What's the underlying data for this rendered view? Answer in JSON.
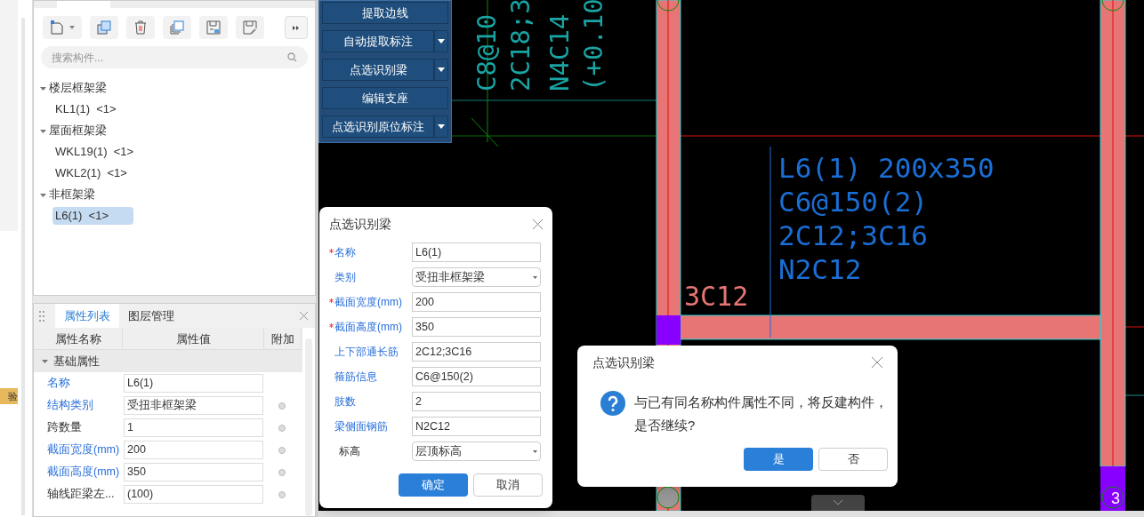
{
  "sidebar_tag": {
    "label": "验"
  },
  "component_panel": {
    "search": {
      "placeholder": "搜索构件..."
    },
    "tree": [
      {
        "label": "楼层框架梁",
        "expanded": true,
        "children": [
          {
            "label": "KL1(1)  <1>",
            "selected": false
          }
        ]
      },
      {
        "label": "屋面框架梁",
        "expanded": true,
        "children": [
          {
            "label": "WKL19(1)  <1>",
            "selected": false
          },
          {
            "label": "WKL2(1)  <1>",
            "selected": false
          }
        ]
      },
      {
        "label": "非框架梁",
        "expanded": true,
        "children": [
          {
            "label": "L6(1)  <1>",
            "selected": true
          }
        ]
      }
    ]
  },
  "property_panel": {
    "tabs": [
      {
        "label": "属性列表",
        "selected": true
      },
      {
        "label": "图层管理",
        "selected": false
      }
    ],
    "columns": [
      "属性名称",
      "属性值",
      "附加"
    ],
    "group": {
      "label": "基础属性",
      "expanded": true
    },
    "rows": [
      {
        "name": "名称",
        "value": "L6(1)",
        "emphasis": true,
        "extra": false
      },
      {
        "name": "结构类别",
        "value": "受扭非框架梁",
        "emphasis": true,
        "extra": true
      },
      {
        "name": "跨数量",
        "value": "1",
        "emphasis": false,
        "extra": true
      },
      {
        "name": "截面宽度(mm)",
        "value": "200",
        "emphasis": true,
        "extra": true
      },
      {
        "name": "截面高度(mm)",
        "value": "350",
        "emphasis": true,
        "extra": true
      },
      {
        "name": "轴线距梁左...",
        "value": "(100)",
        "emphasis": false,
        "extra": true
      }
    ]
  },
  "cad_toolbar": {
    "buttons": [
      {
        "label": "提取边线",
        "dropdown": false
      },
      {
        "label": "自动提取标注",
        "dropdown": true
      },
      {
        "label": "点选识别梁",
        "dropdown": true
      },
      {
        "label": "编辑支座",
        "dropdown": false
      },
      {
        "label": "点选识别原位标注",
        "dropdown": true
      }
    ]
  },
  "drawing": {
    "vertical_texts": [
      "C8@10",
      "2C18;3",
      "N4C14",
      "(+0.10"
    ],
    "beam_label": [
      "L6(1) 200x350",
      "C6@150(2)",
      "2C12;3C16",
      "N2C12"
    ],
    "rebar_label": "3C12",
    "axis_label": "3"
  },
  "beam_dialog": {
    "title": "点选识别梁",
    "fields": [
      {
        "label": "名称",
        "required": true,
        "emphasis": true,
        "kind": "text",
        "value": "L6(1)"
      },
      {
        "label": "类别",
        "required": false,
        "emphasis": true,
        "kind": "select",
        "value": "受扭非框架梁"
      },
      {
        "label": "截面宽度(mm)",
        "required": true,
        "emphasis": true,
        "kind": "text",
        "value": "200"
      },
      {
        "label": "截面高度(mm)",
        "required": true,
        "emphasis": true,
        "kind": "text",
        "value": "350"
      },
      {
        "label": "上下部通长筋",
        "required": false,
        "emphasis": true,
        "kind": "text",
        "value": "2C12;3C16"
      },
      {
        "label": "箍筋信息",
        "required": false,
        "emphasis": true,
        "kind": "text",
        "value": "C6@150(2)"
      },
      {
        "label": "肢数",
        "required": false,
        "emphasis": true,
        "kind": "text",
        "value": "2"
      },
      {
        "label": "梁侧面钢筋",
        "required": false,
        "emphasis": true,
        "kind": "text",
        "value": "N2C12"
      },
      {
        "label": "标高",
        "required": false,
        "emphasis": false,
        "kind": "select",
        "value": "层顶标高"
      }
    ],
    "buttons": [
      {
        "label": "确定",
        "primary": true
      },
      {
        "label": "取消",
        "primary": false
      }
    ]
  },
  "confirm_dialog": {
    "title": "点选识别梁",
    "message": "与已有同名称构件属性不同，将反建构件，是否继续?",
    "buttons": [
      {
        "label": "是",
        "primary": true
      },
      {
        "label": "否",
        "primary": false
      }
    ]
  }
}
